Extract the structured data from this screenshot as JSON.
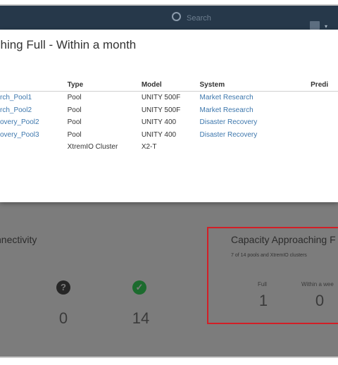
{
  "header": {
    "search_placeholder": "Search",
    "user_caret": "▾"
  },
  "modal": {
    "title": "ching Full - Within a month",
    "columns": [
      "Type",
      "Model",
      "System",
      "Predi"
    ],
    "rows": [
      {
        "name": "rch_Pool1",
        "type": "Pool",
        "model": "UNITY 500F",
        "system": "Market Research"
      },
      {
        "name": "rch_Pool2",
        "type": "Pool",
        "model": "UNITY 500F",
        "system": "Market Research"
      },
      {
        "name": "overy_Pool2",
        "type": "Pool",
        "model": "UNITY 400",
        "system": "Disaster Recovery"
      },
      {
        "name": "overy_Pool3",
        "type": "Pool",
        "model": "UNITY 400",
        "system": "Disaster Recovery"
      },
      {
        "name": "",
        "type": "XtremIO Cluster",
        "model": "X2-T",
        "system": ""
      }
    ]
  },
  "connectivity": {
    "title": "nnectivity",
    "unknown_count": "0",
    "ok_count": "14"
  },
  "capacity": {
    "title": "Capacity Approaching F",
    "subtitle": "7 of 14 pools and XtremIO clusters",
    "full_label": "Full",
    "full_value": "1",
    "week_label": "Within a wee",
    "week_value": "0"
  },
  "colors": {
    "topbar": "#26384a",
    "link": "#3d77ad",
    "highlight": "#d21f26",
    "ok_icon": "#1c6b2e"
  }
}
